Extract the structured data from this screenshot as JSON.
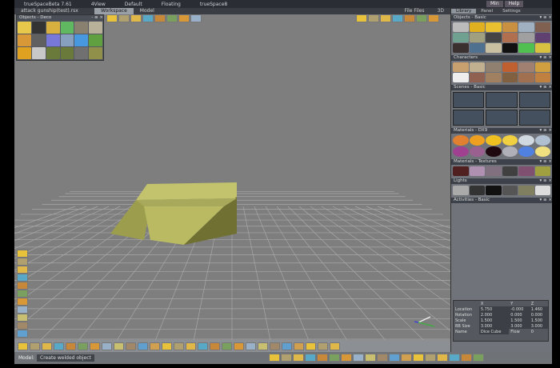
{
  "titlebar": {
    "app": "trueSpaceBeta 7.61",
    "items": [
      "4View",
      "Default",
      "Floating",
      "trueSpace8"
    ],
    "buttons": [
      "Min",
      "Help"
    ]
  },
  "tabs": {
    "file": "attack gunship(test).rsx",
    "items": [
      "Workspace",
      "Model"
    ],
    "active": "Workspace"
  },
  "view_controls": {
    "file_label": "File Files",
    "mode": "3D"
  },
  "left_library": {
    "title": "Objects - Deco"
  },
  "right_panel": {
    "tabs": [
      "Library",
      "Panel",
      "Settings"
    ],
    "active_tab": "Library",
    "sections": [
      {
        "title": "Objects - Basic"
      },
      {
        "title": "Characters"
      },
      {
        "title": "Scenes - Basic"
      },
      {
        "title": "Materials - DX9"
      },
      {
        "title": "Materials - Textures"
      },
      {
        "title": "Lights"
      },
      {
        "title": "Activities - Basic"
      }
    ]
  },
  "properties": {
    "headers": [
      "X",
      "Y",
      "Z"
    ],
    "rows": [
      {
        "label": "Location",
        "values": [
          "5.750",
          "-0.000",
          "1.460"
        ]
      },
      {
        "label": "Rotation",
        "values": [
          "2.000",
          "0.000",
          "0.000"
        ]
      },
      {
        "label": "Scale",
        "values": [
          "1.500",
          "1.500",
          "1.500"
        ]
      },
      {
        "label": "BB Size",
        "values": [
          "3.000",
          "3.000",
          "3.000"
        ]
      }
    ],
    "name_label": "Name",
    "name_value": "Dice Cube",
    "flow_label": "Flow",
    "flow_value": "0"
  },
  "status": {
    "label": "Model:",
    "text": "Create welded object"
  },
  "colors": {
    "object": "#b5b55e",
    "viewport": "#7e7e7e",
    "grid": "#a8a8a8"
  }
}
